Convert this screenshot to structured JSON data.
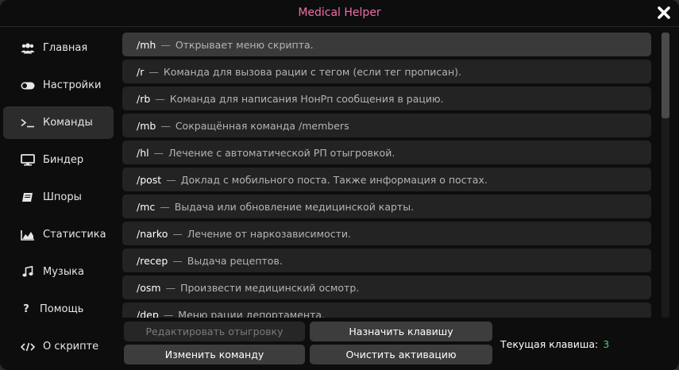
{
  "window": {
    "title": "Medical Helper",
    "accent": "#ee6fa6"
  },
  "sidebar": {
    "items": [
      {
        "label": "Главная",
        "icon": "users-icon"
      },
      {
        "label": "Настройки",
        "icon": "toggle-icon"
      },
      {
        "label": "Команды",
        "icon": "terminal-icon",
        "active": true
      },
      {
        "label": "Биндер",
        "icon": "monitor-icon"
      },
      {
        "label": "Шпоры",
        "icon": "book-icon"
      },
      {
        "label": "Статистика",
        "icon": "area-chart-icon"
      },
      {
        "label": "Музыка",
        "icon": "music-icon"
      },
      {
        "label": "Помощь",
        "icon": "question-icon"
      },
      {
        "label": "О скрипте",
        "icon": "code-icon"
      }
    ]
  },
  "commands": [
    {
      "name": "/mh",
      "dash": "—",
      "desc": "Открывает меню скрипта."
    },
    {
      "name": "/r",
      "dash": "—",
      "desc": "Команда для вызова рации с тегом (если тег прописан)."
    },
    {
      "name": "/rb",
      "dash": "—",
      "desc": "Команда для написания НонРп сообщения в рацию."
    },
    {
      "name": "/mb",
      "dash": "—",
      "desc": "Сокращённая команда /members"
    },
    {
      "name": "/hl",
      "dash": "—",
      "desc": "Лечение с автоматической РП отыгровкой."
    },
    {
      "name": "/post",
      "dash": "—",
      "desc": "Доклад с мобильного поста. Также информация о постах."
    },
    {
      "name": "/mc",
      "dash": "—",
      "desc": "Выдача или обновление медицинской карты."
    },
    {
      "name": "/narko",
      "dash": "—",
      "desc": "Лечение от наркозависимости."
    },
    {
      "name": "/recep",
      "dash": "—",
      "desc": "Выдача рецептов."
    },
    {
      "name": "/osm",
      "dash": "—",
      "desc": "Произвести медицинский осмотр."
    },
    {
      "name": "/dep",
      "dash": "—",
      "desc": "Меню рации депортамента."
    }
  ],
  "buttons": {
    "edit_rp": "Редактировать отыгровку",
    "assign_key": "Назначить клавишу",
    "change_command": "Изменить команду",
    "clear_activation": "Очистить активацию"
  },
  "hotkey": {
    "label": "Текущая клавиша:",
    "value": "3",
    "value_color": "#43d66f"
  }
}
